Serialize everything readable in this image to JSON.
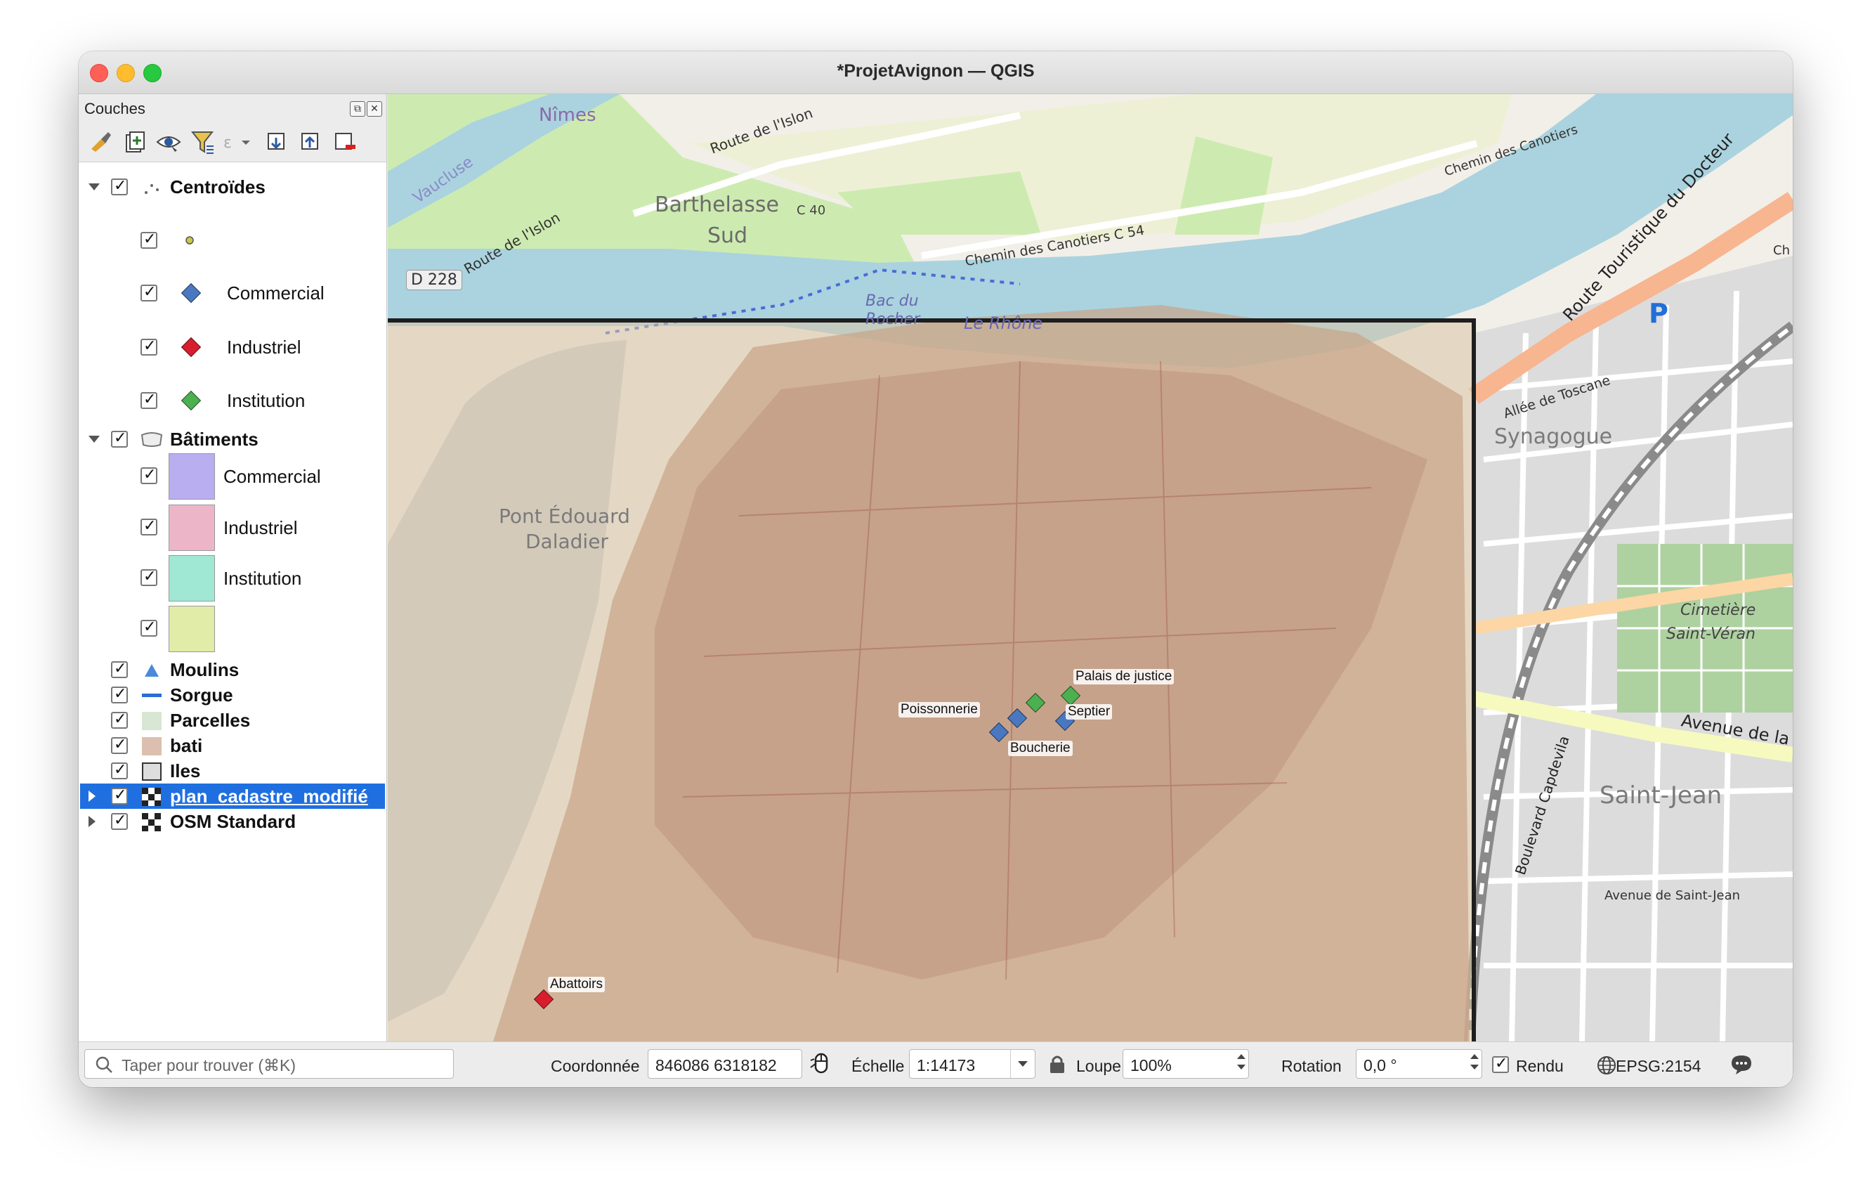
{
  "window": {
    "title": "*ProjetAvignon — QGIS"
  },
  "layers_panel": {
    "title": "Couches",
    "tree": [
      {
        "label": "Centroïdes",
        "bold": true,
        "checked": true
      },
      {
        "label": "",
        "checked": true,
        "symbol_color": "#c8c84a"
      },
      {
        "label": "Commercial",
        "checked": true,
        "symbol_color": "#4a78c0"
      },
      {
        "label": "Industriel",
        "checked": true,
        "symbol_color": "#d81e2c"
      },
      {
        "label": "Institution",
        "checked": true,
        "symbol_color": "#4caf50"
      },
      {
        "label": "Bâtiments",
        "bold": true,
        "checked": true
      },
      {
        "label": "Commercial",
        "checked": true,
        "swatch_color": "#b8aef0"
      },
      {
        "label": "Industriel",
        "checked": true,
        "swatch_color": "#ecb6c8"
      },
      {
        "label": "Institution",
        "checked": true,
        "swatch_color": "#a0e8d4"
      },
      {
        "label": "",
        "checked": true,
        "swatch_color": "#e0eca8"
      },
      {
        "label": "Moulins",
        "bold": true,
        "checked": true
      },
      {
        "label": "Sorgue",
        "bold": true,
        "checked": true
      },
      {
        "label": "Parcelles",
        "bold": true,
        "checked": true
      },
      {
        "label": "bati",
        "bold": true,
        "checked": true
      },
      {
        "label": "Iles",
        "bold": true,
        "checked": true
      },
      {
        "label": "plan_cadastre_modifié",
        "bold": true,
        "checked": true,
        "selected": true
      },
      {
        "label": "OSM Standard",
        "bold": true,
        "checked": true
      }
    ]
  },
  "map": {
    "basemap_labels": {
      "nimes": "Nîmes",
      "route_islon_1": "Route de l'Islon",
      "route_islon_2": "Route de l'Islon",
      "vaucluse": "Vaucluse",
      "barthelasse": "Barthelasse",
      "c40": "C 40",
      "sud": "Sud",
      "chemin_canotiers_1": "Chemin des Canotiers C 54",
      "chemin_canotiers_2": "Chemin des Canotiers",
      "d228": "D 228",
      "bac": "Bac du",
      "rocher": "Rocher",
      "le_rhone": "Le Rhône",
      "pont": "Pont Édouard",
      "daladier": "Daladier",
      "route_touristique": "Route Touristique du Docteur",
      "parking": "P",
      "allee_toscane": "Allée de Toscane",
      "synagogue": "Synagogue",
      "cimetiere": "Cimetière",
      "saint_veran": "Saint-Véran",
      "avenue_folie": "Avenue de la Folie",
      "saint_jean": "Saint-Jean",
      "boulevard_capdevila": "Boulevard Capdevila",
      "avenue_saint_jean": "Avenue de Saint-Jean",
      "ch": "Ch"
    },
    "point_labels": {
      "palais": "Palais de justice",
      "poissonnerie": "Poissonnerie",
      "septier": "Septier",
      "boucherie": "Boucherie",
      "abattoirs": "Abattoirs"
    },
    "colors": {
      "commercial": "#4a78c0",
      "industriel": "#d81e2c",
      "institution": "#4caf50"
    }
  },
  "statusbar": {
    "search_placeholder": "Taper pour trouver (⌘K)",
    "coord_label": "Coordonnée",
    "coord_value": "846086  6318182",
    "scale_label": "Échelle",
    "scale_value": "1:14173",
    "magnifier_label": "Loupe",
    "magnifier_value": "100%",
    "rotation_label": "Rotation",
    "rotation_value": "0,0 °",
    "render_label": "Rendu",
    "crs": "EPSG:2154"
  }
}
